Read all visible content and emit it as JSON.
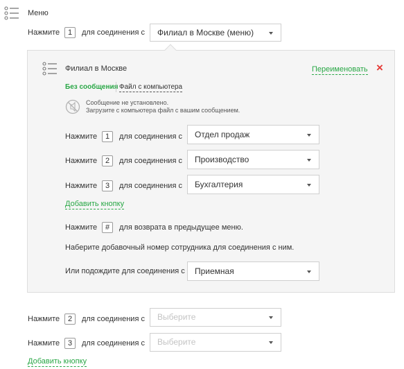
{
  "menu": {
    "title": "Меню",
    "press_label": "Нажмите",
    "connect_label": "для соединения с",
    "row1": {
      "key": "1",
      "value": "Филиал в Москве (меню)"
    },
    "row2": {
      "key": "2",
      "placeholder": "Выберите"
    },
    "row3": {
      "key": "3",
      "placeholder": "Выберите"
    },
    "add_button": "Добавить кнопку"
  },
  "submenu": {
    "title": "Филиал в Москве",
    "rename": "Переименовать",
    "close_symbol": "×",
    "tab_no_message": "Без сообщения",
    "tab_from_computer": "Файл с компьютера",
    "message_line1": "Сообщение не установлено.",
    "message_line2": "Загрузите с компьютера файл с вашим сообщением.",
    "press_label": "Нажмите",
    "connect_label": "для соединения с",
    "rows": [
      {
        "key": "1",
        "value": "Отдел продаж"
      },
      {
        "key": "2",
        "value": "Производство"
      },
      {
        "key": "3",
        "value": "Бухгалтерия"
      }
    ],
    "add_button": "Добавить кнопку",
    "hash_key": "#",
    "back_label": "для возврата в предыдущее меню.",
    "extension_text": "Наберите добавочный номер сотрудника для соединения с ним.",
    "wait_label": "Или подождите для соединения с",
    "wait_value": "Приемная"
  },
  "colors": {
    "accent_green": "#28a745",
    "close_red": "#e53935",
    "panel_bg": "#f5f5f5"
  },
  "icons": [
    "list-icon",
    "no-audio-icon",
    "close-icon",
    "chevron-down-icon"
  ]
}
